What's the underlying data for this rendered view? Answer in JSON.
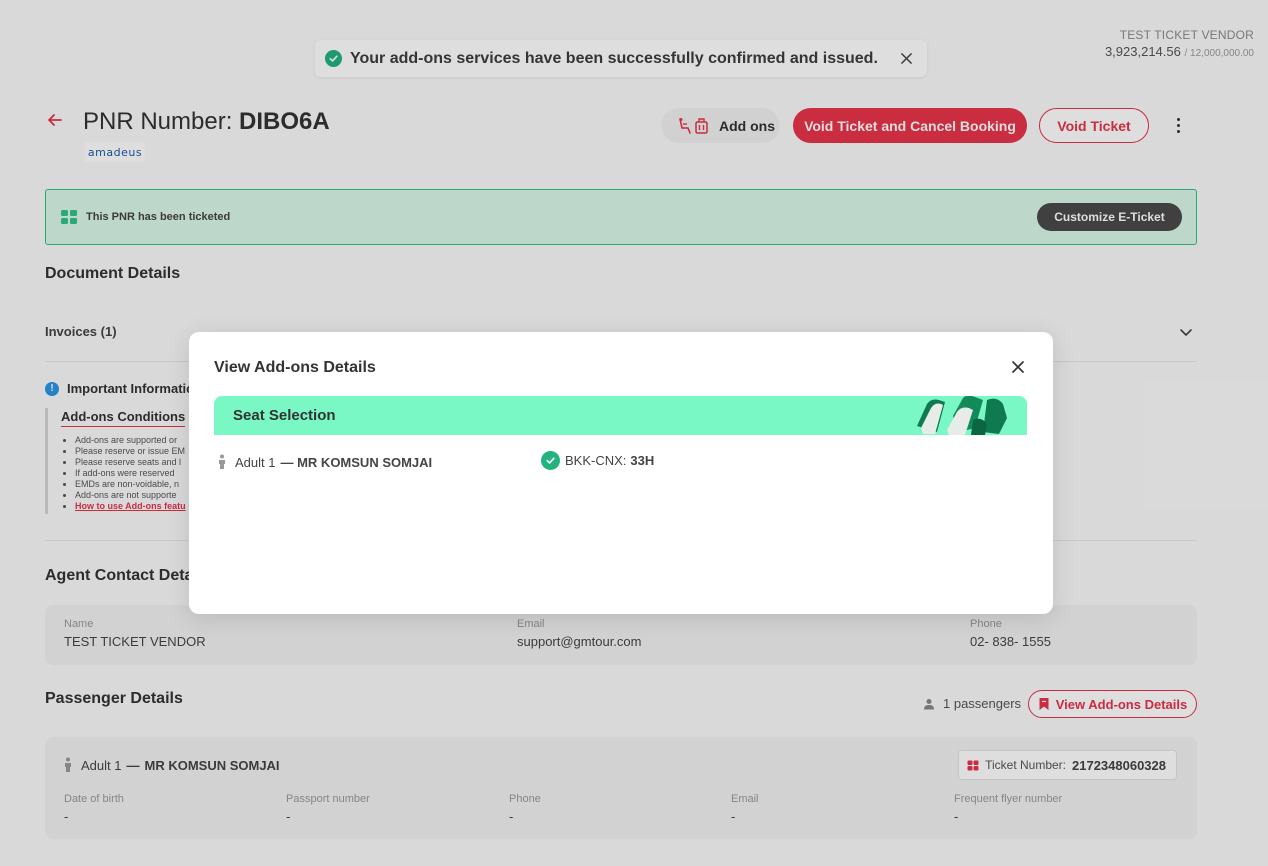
{
  "vendor": {
    "name": "TEST TICKET VENDOR",
    "balance": "3,923,214.56",
    "limit": "/ 12,000,000.00"
  },
  "toast": {
    "message": "Your add-ons services have been successfully confirmed and issued."
  },
  "header": {
    "pnr_label": "PNR Number: ",
    "pnr_code": "DIBO6A",
    "gds": "amadeus",
    "addons_label": "Add ons",
    "void_cancel_label": "Void Ticket and Cancel Booking",
    "void_label": "Void Ticket"
  },
  "ticketed": {
    "text": "This PNR has been ticketed",
    "customize_label": "Customize E-Ticket"
  },
  "document": {
    "title": "Document Details",
    "invoices_label": "Invoices (1)"
  },
  "important": {
    "title": "Important Informatio",
    "conditions_title": "Add-ons Conditions",
    "items": [
      "Add-ons are supported or",
      "Please reserve or issue EM",
      "Please reserve seats and l",
      "If add-ons were reserved",
      "EMDs are non-voidable, n",
      "Add-ons are not supporte"
    ],
    "link_label": "How to use Add-ons featu"
  },
  "agent": {
    "title": "Agent Contact Deta",
    "name_label": "Name",
    "name": "TEST TICKET VENDOR",
    "email_label": "Email",
    "email": "support@gmtour.com",
    "phone_label": "Phone",
    "phone": "02- 838- 1555"
  },
  "passengers": {
    "title": "Passenger Details",
    "count_label": "1 passengers",
    "view_addons_label": "View Add-ons Details",
    "pax_type": "Adult 1",
    "pax_sep": "—",
    "pax_name": "MR KOMSUN SOMJAI",
    "ticket_label": "Ticket Number:",
    "ticket_number": "2172348060328",
    "fields": {
      "dob_label": "Date of birth",
      "dob": "-",
      "passport_label": "Passport number",
      "passport": "-",
      "phone_label": "Phone",
      "phone": "-",
      "email_label": "Email",
      "email": "-",
      "ffn_label": "Frequent flyer number",
      "ffn": "-"
    }
  },
  "modal": {
    "title": "View Add-ons Details",
    "section_label": "Seat Selection",
    "pax_type": "Adult 1",
    "pax_name": "— MR KOMSUN SOMJAI",
    "route": "BKK-CNX:",
    "seat": "33H"
  },
  "colors": {
    "accent": "#e8334a",
    "success": "#23b37f",
    "seat_bar": "#79f7c4"
  }
}
